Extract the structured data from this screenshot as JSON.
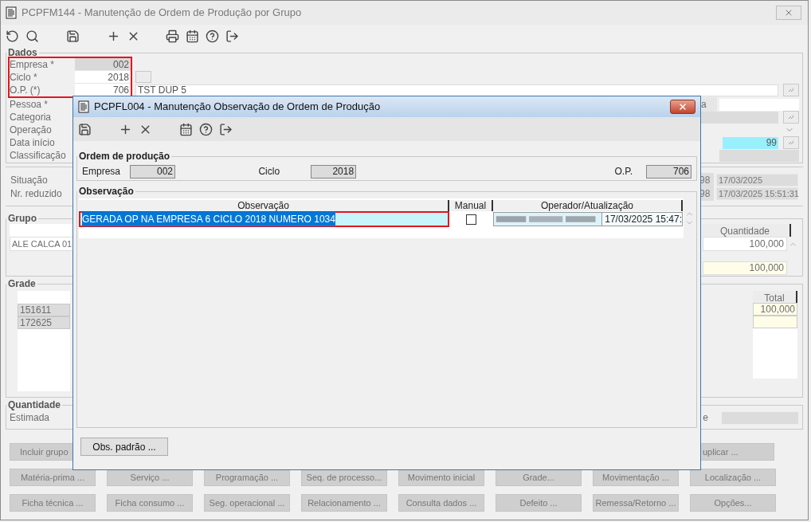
{
  "window": {
    "title": "PCPFM144 - Manutenção de Ordem de Produção por Grupo"
  },
  "dados": {
    "legend": "Dados",
    "key_fields": [
      {
        "label": "Empresa *",
        "value": "002",
        "disabled": true
      },
      {
        "label": "Ciclo *",
        "value": "2018",
        "disabled": false
      },
      {
        "label": "O.P. (*)",
        "value": "706",
        "disabled": false
      }
    ],
    "op_description": "TST DUP 5",
    "labels": [
      "Pessoa *",
      "Categoria",
      "Operação",
      "Data início",
      "Classificação"
    ],
    "pessoa_label_fragment": "a",
    "data_value": "99"
  },
  "situacao": {
    "labels": [
      "Situação",
      "Nr. reduzido"
    ],
    "rows": [
      {
        "code_fragment": "98",
        "date": "17/03/2025"
      },
      {
        "code_fragment": "98",
        "date": "17/03/2025 15:51:31"
      }
    ]
  },
  "grupo": {
    "legend": "Grupo",
    "rows": [
      "ALE CALCA 01"
    ],
    "quantity_header": "Quantidade",
    "quantity": "100,000",
    "total": "100,000"
  },
  "grade": {
    "legend": "Grade",
    "rows": [
      "151611",
      "172625"
    ],
    "total_header": "Total",
    "totals": [
      "100,000"
    ]
  },
  "quantidade": {
    "legend": "Quantidade",
    "label": "Estimada",
    "label_fragment": "e"
  },
  "buttons": [
    [
      "Incluir grupo",
      "uplicar ..."
    ],
    [
      "Matéria-prima ...",
      "Serviço ...",
      "Programação ...",
      "Seq. de processo...",
      "Movimento inicial",
      "Grade...",
      "Movimentação ...",
      "Localização ..."
    ],
    [
      "Ficha técnica ...",
      "Ficha consumo ...",
      "Seg. operacional ...",
      "Relacionamento ...",
      "Consulta dados ...",
      "Defeito ...",
      "Remessa/Retorno ...",
      "Opções..."
    ]
  ],
  "dialog": {
    "title": "PCPFL004 - Manutenção Observação de Ordem de Produção",
    "ordem": {
      "legend": "Ordem de produção",
      "fields": [
        {
          "label": "Empresa",
          "value": "002"
        },
        {
          "label": "Ciclo",
          "value": "2018"
        },
        {
          "label": "O.P.",
          "value": "706"
        }
      ]
    },
    "observacao": {
      "legend": "Observação",
      "columns": [
        "Observação",
        "Manual",
        "Operador/Atualização"
      ],
      "rows": [
        {
          "text": "GERADA OP NA EMPRESA 6 CICLO 2018 NUMERO 1034",
          "manual": false,
          "updated": "17/03/2025 15:47:",
          "selected": true
        }
      ]
    },
    "button": "Obs. padrão ..."
  }
}
